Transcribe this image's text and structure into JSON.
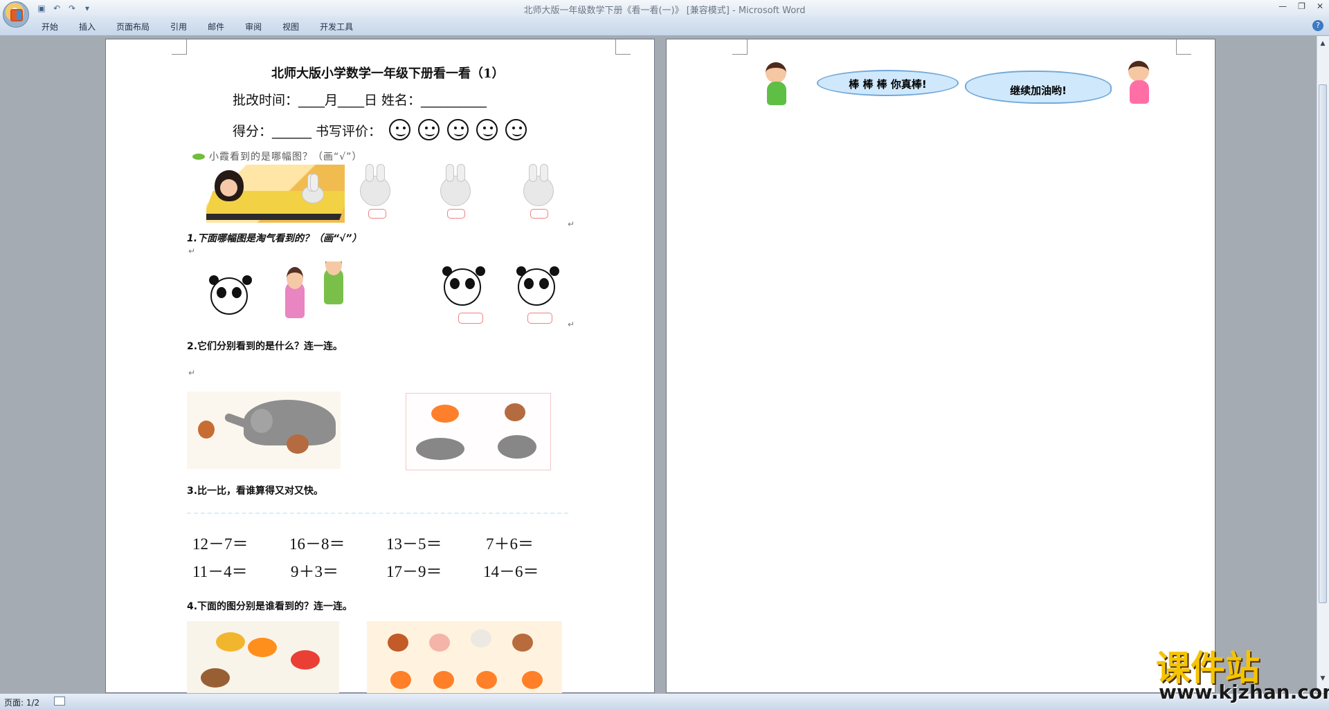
{
  "window": {
    "title": "北师大版一年级数学下册《看一看(一)》 [兼容模式] - Microsoft Word",
    "minimize_label": "—",
    "restore_label": "❐",
    "close_label": "✕",
    "help_label": "?"
  },
  "quick_access": {
    "save_icon": "save-icon",
    "undo_icon": "undo-icon",
    "redo_icon": "redo-icon",
    "customize_label": "▾"
  },
  "ribbon": {
    "tabs": [
      "开始",
      "插入",
      "页面布局",
      "引用",
      "邮件",
      "审阅",
      "视图",
      "开发工具"
    ]
  },
  "document": {
    "title": "北师大版小学数学一年级下册看一看（1）",
    "info_line": "批改时间：____月____日        姓名：__________",
    "score_line": "得分：______     书写评价：",
    "section0": "小霞看到的是哪幅图？（画“√”）",
    "question1": "1.下面哪幅图是淘气看到的？（画“√”）",
    "question2": "2.它们分别看到的是什么？连一连。",
    "question3": "3.比一比，看谁算得又对又快。",
    "question4": "4.下面的图分别是谁看到的？连一连。",
    "math_rows": [
      [
        "12－7＝",
        "16－8＝",
        "13－5＝",
        "7＋6＝"
      ],
      [
        "11－4＝",
        "9＋3＝",
        "17－9＝",
        "14－6＝"
      ]
    ]
  },
  "page2": {
    "cloud1": "棒 棒 棒 你真棒!",
    "cloud2": "继续加油哟!"
  },
  "status": {
    "page": "页面: 1/2"
  },
  "watermark": {
    "main": "课件站",
    "url": "www.kjzhan.com"
  },
  "colors": {
    "word_blue": "#c7d7ea",
    "watermark_yellow": "#f5c400",
    "cloud_blue": "#cfe8fb"
  }
}
